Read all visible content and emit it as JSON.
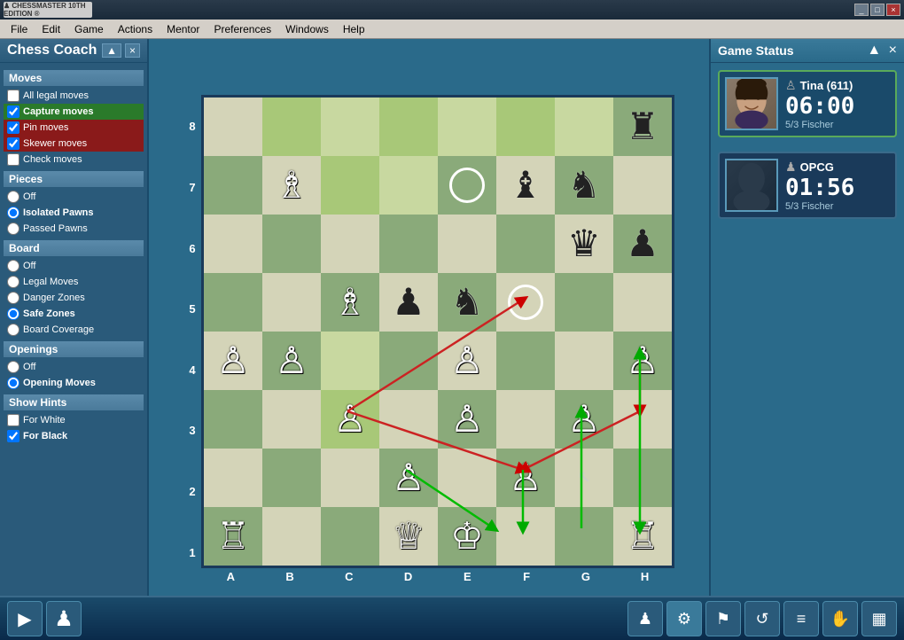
{
  "titlebar": {
    "logo": "CHESSMASTER",
    "subtitle": "10TH EDITION",
    "controls": [
      "_",
      "□",
      "×"
    ]
  },
  "menubar": {
    "items": [
      "File",
      "Edit",
      "Game",
      "Actions",
      "Mentor",
      "Preferences",
      "Windows",
      "Help"
    ]
  },
  "coach": {
    "title": "Chess Coach",
    "expand": "▲",
    "close": "×",
    "sections": {
      "moves": "Moves",
      "pieces": "Pieces",
      "board": "Board",
      "openings": "Openings",
      "hints": "Show Hints"
    },
    "moves_options": [
      {
        "id": "all-legal",
        "label": "All legal moves",
        "checked": false,
        "type": "checkbox"
      },
      {
        "id": "capture",
        "label": "Capture moves",
        "checked": true,
        "type": "checkbox",
        "highlight": "green"
      },
      {
        "id": "pin",
        "label": "Pin moves",
        "checked": true,
        "type": "checkbox",
        "highlight": "red"
      },
      {
        "id": "skewer",
        "label": "Skewer moves",
        "checked": true,
        "type": "checkbox",
        "highlight": "red"
      },
      {
        "id": "check",
        "label": "Check moves",
        "checked": false,
        "type": "checkbox"
      }
    ],
    "pieces_options": [
      {
        "id": "pieces-off",
        "label": "Off",
        "checked": false,
        "type": "radio"
      },
      {
        "id": "isolated",
        "label": "Isolated Pawns",
        "checked": true,
        "type": "radio"
      },
      {
        "id": "passed",
        "label": "Passed Pawns",
        "checked": false,
        "type": "radio"
      }
    ],
    "board_options": [
      {
        "id": "board-off",
        "label": "Off",
        "checked": false,
        "type": "radio"
      },
      {
        "id": "legal-moves",
        "label": "Legal Moves",
        "checked": false,
        "type": "radio"
      },
      {
        "id": "danger-zones",
        "label": "Danger Zones",
        "checked": false,
        "type": "radio"
      },
      {
        "id": "safe-zones",
        "label": "Safe Zones",
        "checked": true,
        "type": "radio"
      },
      {
        "id": "board-coverage",
        "label": "Board Coverage",
        "checked": false,
        "type": "radio"
      }
    ],
    "openings_options": [
      {
        "id": "openings-off",
        "label": "Off",
        "checked": false,
        "type": "radio"
      },
      {
        "id": "opening-moves",
        "label": "Opening Moves",
        "checked": true,
        "type": "radio"
      }
    ],
    "hints_options": [
      {
        "id": "for-white",
        "label": "For White",
        "checked": false,
        "type": "checkbox"
      },
      {
        "id": "for-black",
        "label": "For Black",
        "checked": true,
        "type": "checkbox"
      }
    ]
  },
  "game_status": {
    "title": "Game Status",
    "player1": {
      "name": "Tina (611)",
      "time": "06:00",
      "rating": "5/3 Fischer",
      "is_human": true
    },
    "player2": {
      "name": "OPCG",
      "time": "01:56",
      "rating": "5/3 Fischer",
      "is_computer": true
    }
  },
  "board": {
    "col_labels": [
      "A",
      "B",
      "C",
      "D",
      "E",
      "F",
      "G",
      "H"
    ],
    "row_labels": [
      "8",
      "7",
      "6",
      "5",
      "4",
      "3",
      "2",
      "1"
    ]
  },
  "bottom_icons": [
    "▶",
    "♟",
    "♟"
  ],
  "bottom_right_icons": [
    "♟",
    "♟",
    "♟",
    "♟",
    "♟",
    "♟",
    "♟"
  ]
}
